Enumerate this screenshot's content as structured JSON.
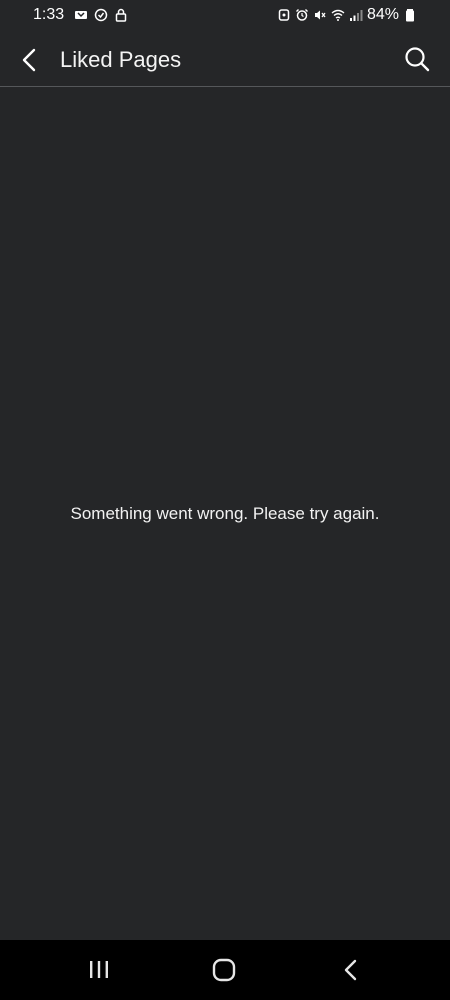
{
  "status_bar": {
    "time": "1:33",
    "battery": "84%",
    "left_icons": [
      "notification-icon",
      "check-circle-icon",
      "lock-icon"
    ],
    "right_icons": [
      "alarm-face-icon",
      "alarm-clock-icon",
      "mute-icon",
      "wifi-icon",
      "signal-icon",
      "battery-icon"
    ]
  },
  "app_bar": {
    "title": "Liked Pages",
    "back_icon": "back-arrow-icon",
    "search_icon": "search-icon"
  },
  "main": {
    "message": "Something went wrong. Please try again."
  },
  "nav_bar": {
    "buttons": [
      "recents-icon",
      "home-icon",
      "back-icon"
    ]
  },
  "colors": {
    "background": "#252628",
    "text": "#f2f2f2",
    "divider": "#55575a",
    "nav_background": "#000000"
  }
}
